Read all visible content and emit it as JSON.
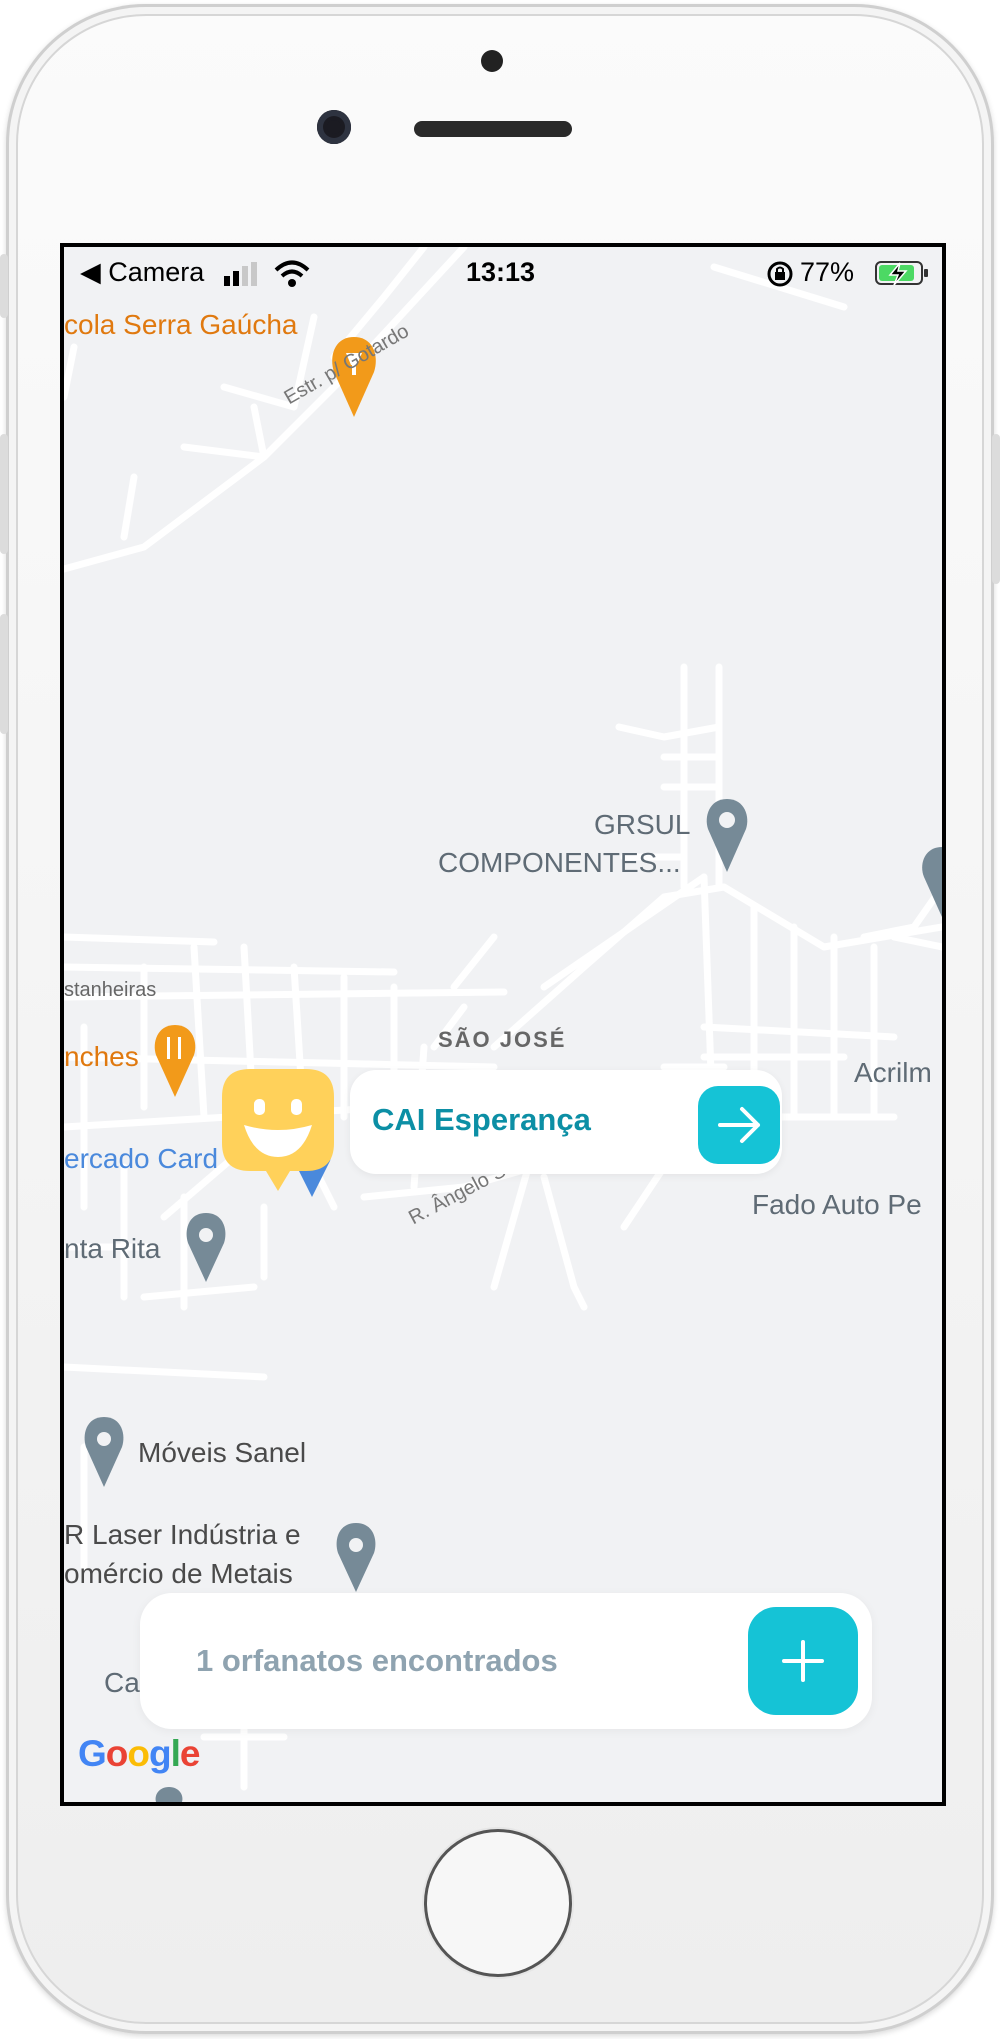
{
  "status_bar": {
    "back_app": "◀ Camera",
    "time": "13:13",
    "battery": "77%"
  },
  "map_labels": {
    "winery": "cola Serra Gaúcha",
    "road_gotardo": "Estr. p/ Gotardo",
    "grsul_line1": "GRSUL",
    "grsul_line2": "COMPONENTES...",
    "castanheiras": "stanheiras",
    "district": "SÃO JOSÉ",
    "lanches": "nches",
    "acrilm": "Acrilm",
    "mercado": "ercado Card",
    "road_angelo": "R. Ângelo Slot",
    "fado": "Fado Auto Pe",
    "santa_rita": "nta Rita",
    "moveis": "Móveis Sanel",
    "laser_line1": "R Laser Indústria e",
    "laser_line2": "omércio de Metais",
    "ca": "Ca"
  },
  "callout": {
    "name": "CAI Esperança"
  },
  "footer": {
    "count_text": "1 orfanatos encontrados"
  },
  "attribution": "Google",
  "colors": {
    "accent": "#15c3d6",
    "marker": "#ffd15a",
    "callout_text": "#0c8fa5",
    "footer_text": "#8fa3b0"
  }
}
